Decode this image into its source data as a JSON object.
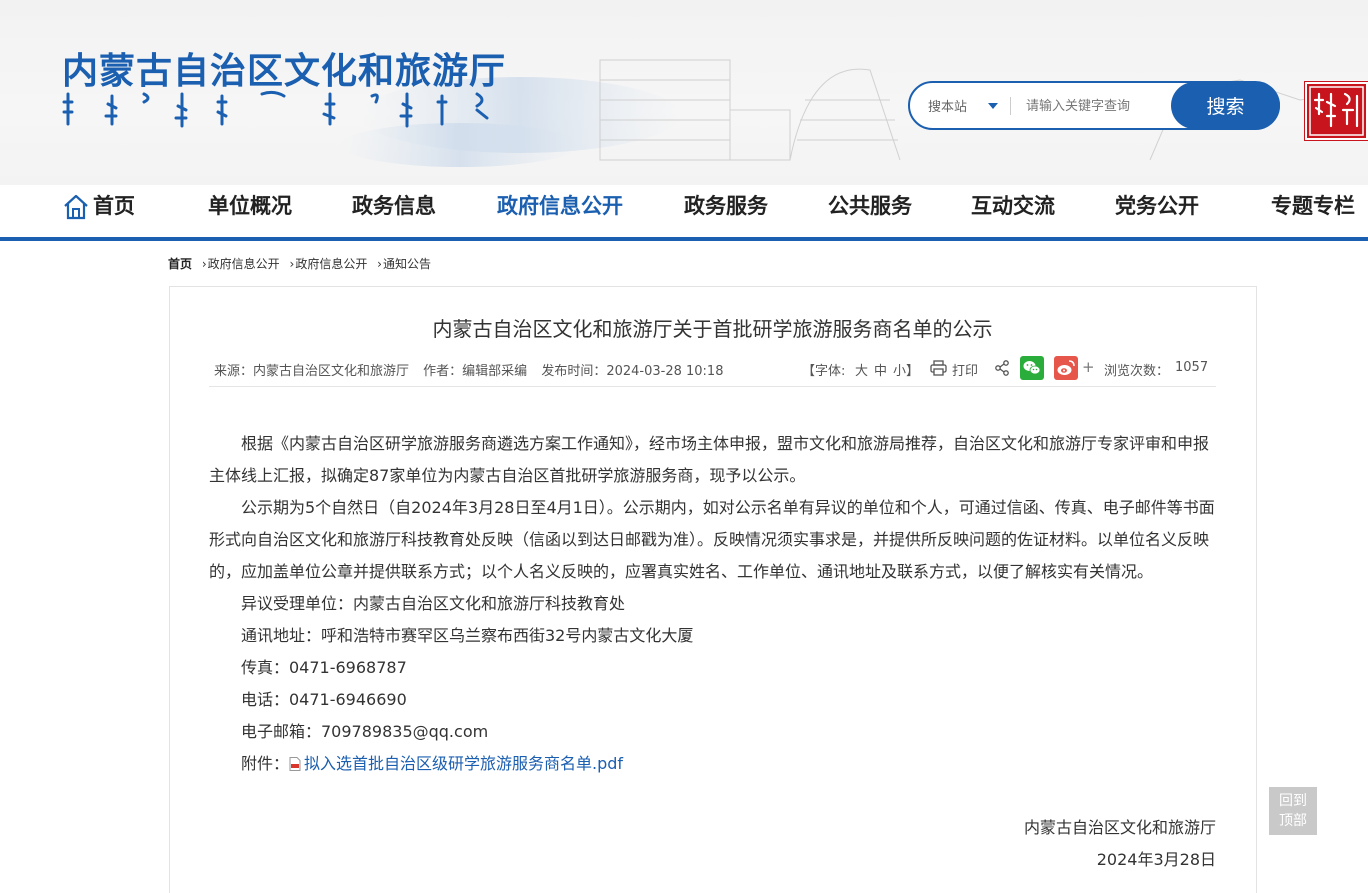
{
  "header": {
    "site_title": "内蒙古自治区文化和旅游厅",
    "search": {
      "scope_label": "搜本站",
      "placeholder": "请输入关键字查询",
      "button_label": "搜索"
    }
  },
  "nav": {
    "items": [
      {
        "label": "首页"
      },
      {
        "label": "单位概况"
      },
      {
        "label": "政务信息"
      },
      {
        "label": "政府信息公开"
      },
      {
        "label": "政务服务"
      },
      {
        "label": "公共服务"
      },
      {
        "label": "互动交流"
      },
      {
        "label": "党务公开"
      },
      {
        "label": "专题专栏"
      }
    ],
    "active_index": 3
  },
  "breadcrumb": {
    "home": "首页",
    "items": [
      "政府信息公开",
      "政府信息公开",
      "通知公告"
    ]
  },
  "article": {
    "title": "内蒙古自治区文化和旅游厅关于首批研学旅游服务商名单的公示",
    "meta": {
      "source": "来源：内蒙古自治区文化和旅游厅",
      "author": "作者：编辑部采编",
      "published": "发布时间：2024-03-28 10:18",
      "font_label_prefix": "【字体:",
      "font_large": "大",
      "font_medium": "中",
      "font_small": "小",
      "font_label_suffix": "】",
      "print_label": "打印",
      "plus": "+",
      "views_label": "浏览次数：",
      "views": "1057"
    },
    "paragraphs": [
      "根据《内蒙古自治区研学旅游服务商遴选方案工作通知》，经市场主体申报，盟市文化和旅游局推荐，自治区文化和旅游厅专家评审和申报主体线上汇报，拟确定87家单位为内蒙古自治区首批研学旅游服务商，现予以公示。",
      "公示期为5个自然日（自2024年3月28日至4月1日）。公示期内，如对公示名单有异议的单位和个人，可通过信函、传真、电子邮件等书面形式向自治区文化和旅游厅科技教育处反映（信函以到达日邮戳为准）。反映情况须实事求是，并提供所反映问题的佐证材料。以单位名义反映的，应加盖单位公章并提供联系方式；以个人名义反映的，应署真实姓名、工作单位、通讯地址及联系方式，以便了解核实有关情况。",
      "异议受理单位：内蒙古自治区文化和旅游厅科技教育处",
      "通讯地址：呼和浩特市赛罕区乌兰察布西街32号内蒙古文化大厦",
      "传真：0471-6968787",
      "电话：0471-6946690",
      "电子邮箱：709789835@qq.com"
    ],
    "attachment_label": "附件：",
    "attachment_name": "拟入选首批自治区级研学旅游服务商名单.pdf",
    "signature_org": "内蒙古自治区文化和旅游厅",
    "signature_date": "2024年3月28日"
  },
  "back_to_top": {
    "line1": "回到",
    "line2": "顶部"
  },
  "colors": {
    "brand_blue": "#1b5fb0",
    "seal_red": "#c8141c",
    "wechat_green": "#2bad3b",
    "weibo_red": "#e6564a"
  },
  "icons": [
    "home-icon",
    "chevron-down-icon",
    "printer-icon",
    "share-icon",
    "wechat-icon",
    "weibo-icon",
    "pdf-icon"
  ]
}
